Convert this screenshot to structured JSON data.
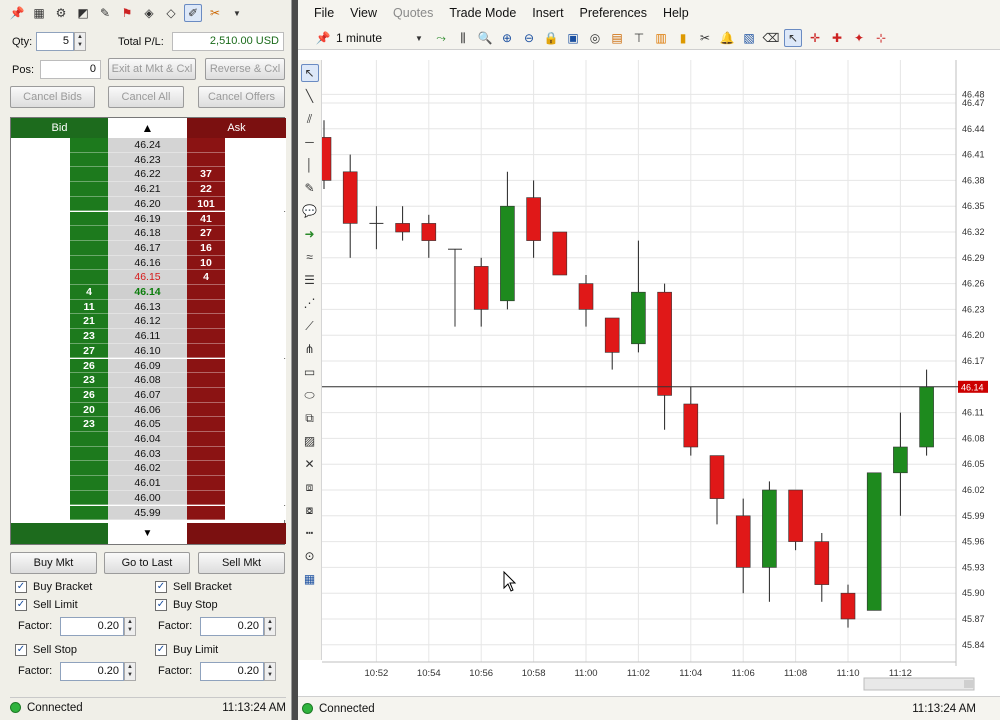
{
  "order_panel": {
    "toolbar_icons": [
      "pin-icon",
      "calculator-icon",
      "settings-icon",
      "chart-icon",
      "note-icon",
      "alert-icon",
      "shield-icon",
      "alerts-icon",
      "draw-icon",
      "dropdown-icon"
    ],
    "qty_label": "Qty:",
    "qty_value": "5",
    "pl_label": "Total P/L:",
    "pl_value": "2,510.00 USD",
    "pos_label": "Pos:",
    "pos_value": "0",
    "exit_label": "Exit at Mkt & Cxl",
    "reverse_label": "Reverse & Cxl",
    "cancel_bids_label": "Cancel Bids",
    "cancel_all_label": "Cancel All",
    "cancel_offers_label": "Cancel Offers",
    "bid_header": "Bid",
    "ask_header": "Ask",
    "ladder": [
      {
        "price": "46.24",
        "bid": "",
        "ask": ""
      },
      {
        "price": "46.23",
        "bid": "",
        "ask": ""
      },
      {
        "price": "46.22",
        "bid": "",
        "ask": "37"
      },
      {
        "price": "46.21",
        "bid": "",
        "ask": "22"
      },
      {
        "price": "46.20",
        "bid": "",
        "ask": "101"
      },
      {
        "price": "46.19",
        "bid": "",
        "ask": "41"
      },
      {
        "price": "46.18",
        "bid": "",
        "ask": "27"
      },
      {
        "price": "46.17",
        "bid": "",
        "ask": "16"
      },
      {
        "price": "46.16",
        "bid": "",
        "ask": "10"
      },
      {
        "price": "46.15",
        "bid": "",
        "ask": "4"
      },
      {
        "price": "46.14",
        "bid": "4",
        "ask": ""
      },
      {
        "price": "46.13",
        "bid": "11",
        "ask": ""
      },
      {
        "price": "46.12",
        "bid": "21",
        "ask": ""
      },
      {
        "price": "46.11",
        "bid": "23",
        "ask": ""
      },
      {
        "price": "46.10",
        "bid": "27",
        "ask": ""
      },
      {
        "price": "46.09",
        "bid": "26",
        "ask": ""
      },
      {
        "price": "46.08",
        "bid": "23",
        "ask": ""
      },
      {
        "price": "46.07",
        "bid": "26",
        "ask": ""
      },
      {
        "price": "46.06",
        "bid": "20",
        "ask": ""
      },
      {
        "price": "46.05",
        "bid": "23",
        "ask": ""
      },
      {
        "price": "46.04",
        "bid": "",
        "ask": ""
      },
      {
        "price": "46.03",
        "bid": "",
        "ask": ""
      },
      {
        "price": "46.02",
        "bid": "",
        "ask": ""
      },
      {
        "price": "46.01",
        "bid": "",
        "ask": ""
      },
      {
        "price": "46.00",
        "bid": "",
        "ask": ""
      },
      {
        "price": "45.99",
        "bid": "",
        "ask": ""
      }
    ],
    "buy_mkt_label": "Buy Mkt",
    "go_to_last_label": "Go to Last",
    "sell_mkt_label": "Sell Mkt",
    "buy_bracket_label": "Buy Bracket",
    "sell_bracket_label": "Sell Bracket",
    "sell_limit_label": "Sell Limit",
    "buy_stop_label": "Buy Stop",
    "sell_stop_label": "Sell Stop",
    "buy_limit_label": "Buy Limit",
    "factor_label": "Factor:",
    "factor_value": "0.20",
    "status_text": "Connected",
    "time": "11:13:24 AM"
  },
  "chart_window": {
    "menu": [
      "File",
      "View",
      "Quotes",
      "Trade Mode",
      "Insert",
      "Preferences",
      "Help"
    ],
    "interval": "1 minute",
    "last_price_tag": "46.14",
    "status_text": "Connected",
    "time": "11:13:24 AM"
  },
  "colors": {
    "bid": "#1d7a1d",
    "ask": "#8b1313",
    "up": "#1e8a1e",
    "down": "#e01818",
    "highlight_bid": "#0f8a0f",
    "highlight_ask": "#e02020"
  },
  "chart_data": {
    "type": "candlestick",
    "ylim": [
      45.82,
      46.52
    ],
    "yticks": [
      "46.48",
      "46.47",
      "46.44",
      "46.41",
      "46.38",
      "46.35",
      "46.32",
      "46.29",
      "46.26",
      "46.23",
      "46.20",
      "46.17",
      "46.14",
      "46.11",
      "46.08",
      "46.05",
      "46.02",
      "45.99",
      "45.96",
      "45.93",
      "45.90",
      "45.87",
      "45.84"
    ],
    "xticks": [
      "10:52",
      "10:54",
      "10:56",
      "10:58",
      "11:00",
      "11:02",
      "11:04",
      "11:06",
      "11:08",
      "11:10",
      "11:12"
    ],
    "last_price": 46.14,
    "candles": [
      {
        "t": "10:50",
        "o": 46.43,
        "h": 46.45,
        "l": 46.37,
        "c": 46.38
      },
      {
        "t": "10:51",
        "o": 46.39,
        "h": 46.41,
        "l": 46.29,
        "c": 46.33
      },
      {
        "t": "10:52",
        "o": 46.33,
        "h": 46.35,
        "l": 46.3,
        "c": 46.33
      },
      {
        "t": "10:53",
        "o": 46.33,
        "h": 46.35,
        "l": 46.31,
        "c": 46.32
      },
      {
        "t": "10:54",
        "o": 46.33,
        "h": 46.34,
        "l": 46.29,
        "c": 46.31
      },
      {
        "t": "10:55",
        "o": 46.3,
        "h": 46.3,
        "l": 46.21,
        "c": 46.3
      },
      {
        "t": "10:56",
        "o": 46.28,
        "h": 46.29,
        "l": 46.21,
        "c": 46.23
      },
      {
        "t": "10:57",
        "o": 46.24,
        "h": 46.39,
        "l": 46.23,
        "c": 46.35
      },
      {
        "t": "10:58",
        "o": 46.36,
        "h": 46.38,
        "l": 46.29,
        "c": 46.31
      },
      {
        "t": "10:59",
        "o": 46.32,
        "h": 46.32,
        "l": 46.27,
        "c": 46.27
      },
      {
        "t": "11:00",
        "o": 46.26,
        "h": 46.27,
        "l": 46.21,
        "c": 46.23
      },
      {
        "t": "11:01",
        "o": 46.22,
        "h": 46.22,
        "l": 46.16,
        "c": 46.18
      },
      {
        "t": "11:02",
        "o": 46.19,
        "h": 46.31,
        "l": 46.18,
        "c": 46.25
      },
      {
        "t": "11:03",
        "o": 46.25,
        "h": 46.26,
        "l": 46.09,
        "c": 46.13
      },
      {
        "t": "11:04",
        "o": 46.12,
        "h": 46.14,
        "l": 46.06,
        "c": 46.07
      },
      {
        "t": "11:05",
        "o": 46.06,
        "h": 46.06,
        "l": 45.98,
        "c": 46.01
      },
      {
        "t": "11:06",
        "o": 45.99,
        "h": 46.01,
        "l": 45.9,
        "c": 45.93
      },
      {
        "t": "11:07",
        "o": 45.93,
        "h": 46.03,
        "l": 45.89,
        "c": 46.02
      },
      {
        "t": "11:08",
        "o": 46.02,
        "h": 46.02,
        "l": 45.95,
        "c": 45.96
      },
      {
        "t": "11:09",
        "o": 45.96,
        "h": 45.97,
        "l": 45.89,
        "c": 45.91
      },
      {
        "t": "11:10",
        "o": 45.9,
        "h": 45.91,
        "l": 45.86,
        "c": 45.87
      },
      {
        "t": "11:11",
        "o": 45.88,
        "h": 46.04,
        "l": 45.88,
        "c": 46.04
      },
      {
        "t": "11:12",
        "o": 46.04,
        "h": 46.11,
        "l": 45.99,
        "c": 46.07
      },
      {
        "t": "11:13",
        "o": 46.07,
        "h": 46.16,
        "l": 46.06,
        "c": 46.14
      }
    ]
  }
}
